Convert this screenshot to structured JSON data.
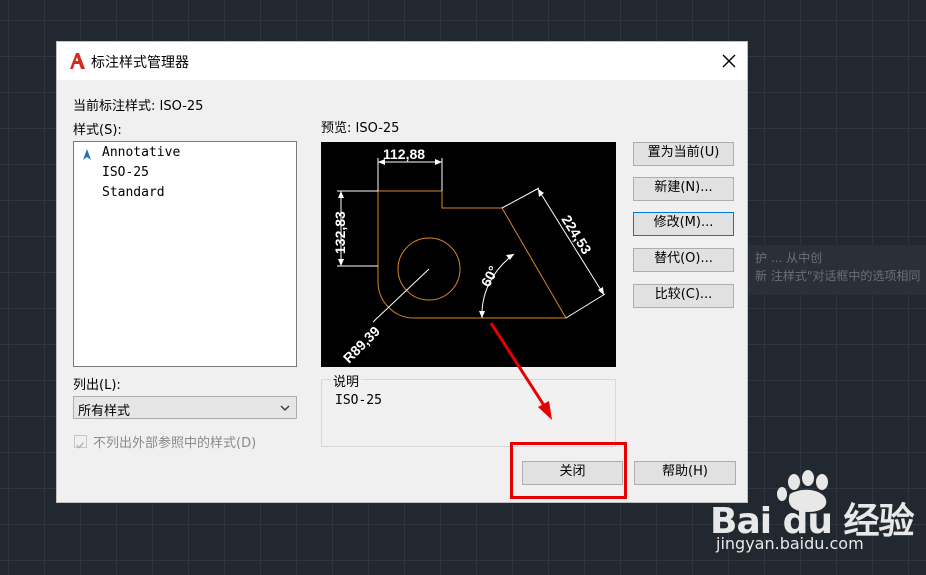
{
  "dialog": {
    "title": "标注样式管理器",
    "current_style_label": "当前标注样式: ISO-25",
    "styles_label": "样式(S):",
    "styles": [
      "Annotative",
      "ISO-25",
      "Standard"
    ],
    "list_label": "列出(L):",
    "list_value": "所有样式",
    "exclude_xref_label": "不列出外部参照中的样式(D)",
    "exclude_xref_checked": true,
    "preview_label": "预览: ISO-25",
    "description_title": "说明",
    "description_text": "ISO-25",
    "buttons": {
      "set_current": "置为当前(U)",
      "new": "新建(N)...",
      "modify": "修改(M)...",
      "override": "替代(O)...",
      "compare": "比较(C)...",
      "close": "关闭",
      "help": "帮助(H)"
    }
  },
  "preview_dims": {
    "top": "112,88",
    "left": "132,83",
    "right": "224,53",
    "angle": "60°",
    "radius": "R89,39"
  },
  "background_tooltip": {
    "line1": "护      ...  从中创",
    "line2": "新      注样式\"对话框中的选项相同"
  },
  "watermark": {
    "brand": "Bai du 经验",
    "url": "jingyan.baidu.com"
  },
  "colors": {
    "accent": "#0078d7",
    "highlight": "#e60000",
    "preview_line": "#ff9900",
    "preview_bg": "#000000"
  },
  "icons": {
    "app": "autocad-logo-icon",
    "close": "close-icon",
    "annotative": "annotative-icon",
    "dropdown": "chevron-down-icon"
  }
}
